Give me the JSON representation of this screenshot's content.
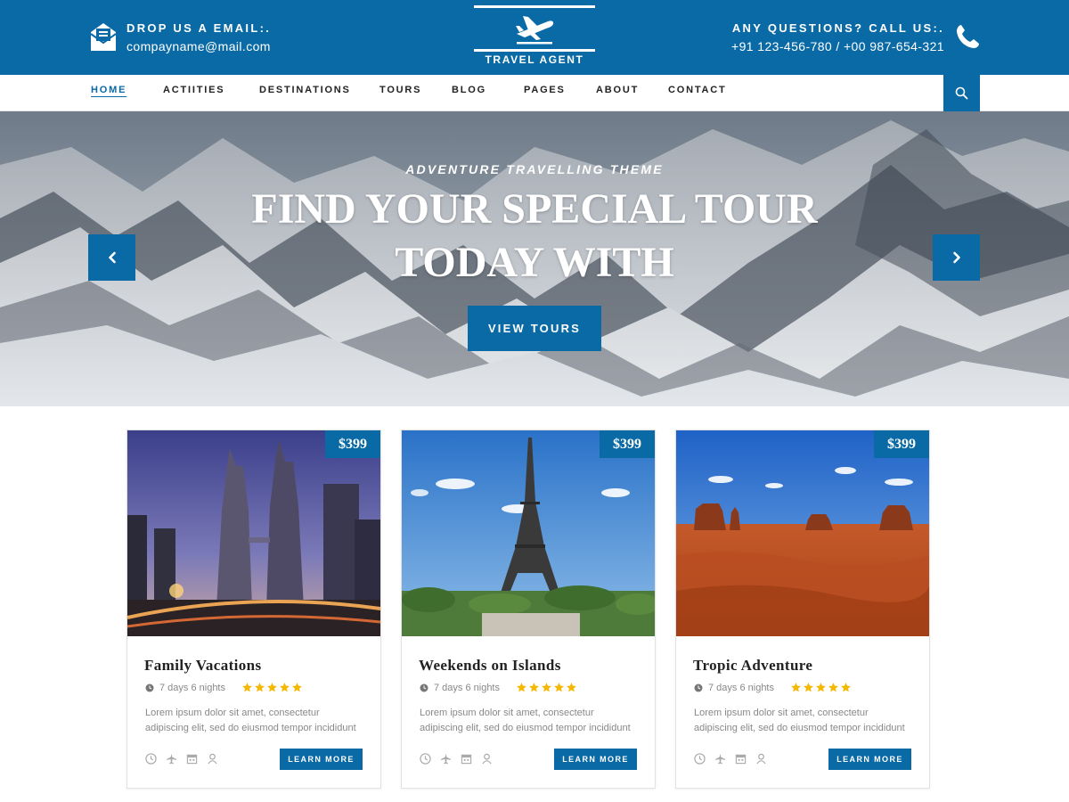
{
  "header": {
    "email_title": "DROP US A EMAIL:.",
    "email_value": "compayname@mail.com",
    "phone_title": "ANY QUESTIONS? CALL US:.",
    "phone_value": "+91 123-456-780 / +00 987-654-321",
    "logo_text": "TRAVEL AGENT",
    "icons": {
      "email": "email-envelope-icon",
      "phone": "phone-icon",
      "logo": "airplane-icon"
    }
  },
  "nav": {
    "items": [
      {
        "label": "HOME",
        "active": true
      },
      {
        "label": "ACTIITIES"
      },
      {
        "label": "DESTINATIONS"
      },
      {
        "label": "TOURS"
      },
      {
        "label": "BLOG"
      },
      {
        "label": "PAGES"
      },
      {
        "label": "ABOUT"
      },
      {
        "label": "CONTACT"
      }
    ],
    "search_icon": "search-icon"
  },
  "hero": {
    "subtitle": "ADVENTURE TRAVELLING THEME",
    "title_line1": "FIND YOUR SPECIAL TOUR",
    "title_line2": "TODAY WITH",
    "button": "VIEW TOURS",
    "prev_icon": "chevron-left-icon",
    "next_icon": "chevron-right-icon"
  },
  "cards": [
    {
      "price": "$399",
      "title": "Family Vacations",
      "duration": "7 days 6 nights",
      "rating": 5,
      "desc_line1": "Lorem ipsum dolor sit amet, consectetur",
      "desc_line2": "adipiscing elit, sed do eiusmod tempor incididunt",
      "button": "LEARN MORE"
    },
    {
      "price": "$399",
      "title": "Weekends on Islands",
      "duration": "7 days 6 nights",
      "rating": 5,
      "desc_line1": "Lorem ipsum dolor sit amet, consectetur",
      "desc_line2": "adipiscing elit, sed do eiusmod tempor incididunt",
      "button": "LEARN MORE"
    },
    {
      "price": "$399",
      "title": "Tropic Adventure",
      "duration": "7 days 6 nights",
      "rating": 5,
      "desc_line1": "Lorem ipsum dolor sit amet, consectetur",
      "desc_line2": "adipiscing elit, sed do eiusmod tempor incididunt",
      "button": "LEARN MORE"
    }
  ],
  "card_meta_icons": [
    "clock-icon",
    "airplane-icon",
    "calendar-icon",
    "user-icon"
  ],
  "colors": {
    "primary": "#0a6aa6",
    "star": "#f5b800",
    "text_muted": "#888888"
  }
}
